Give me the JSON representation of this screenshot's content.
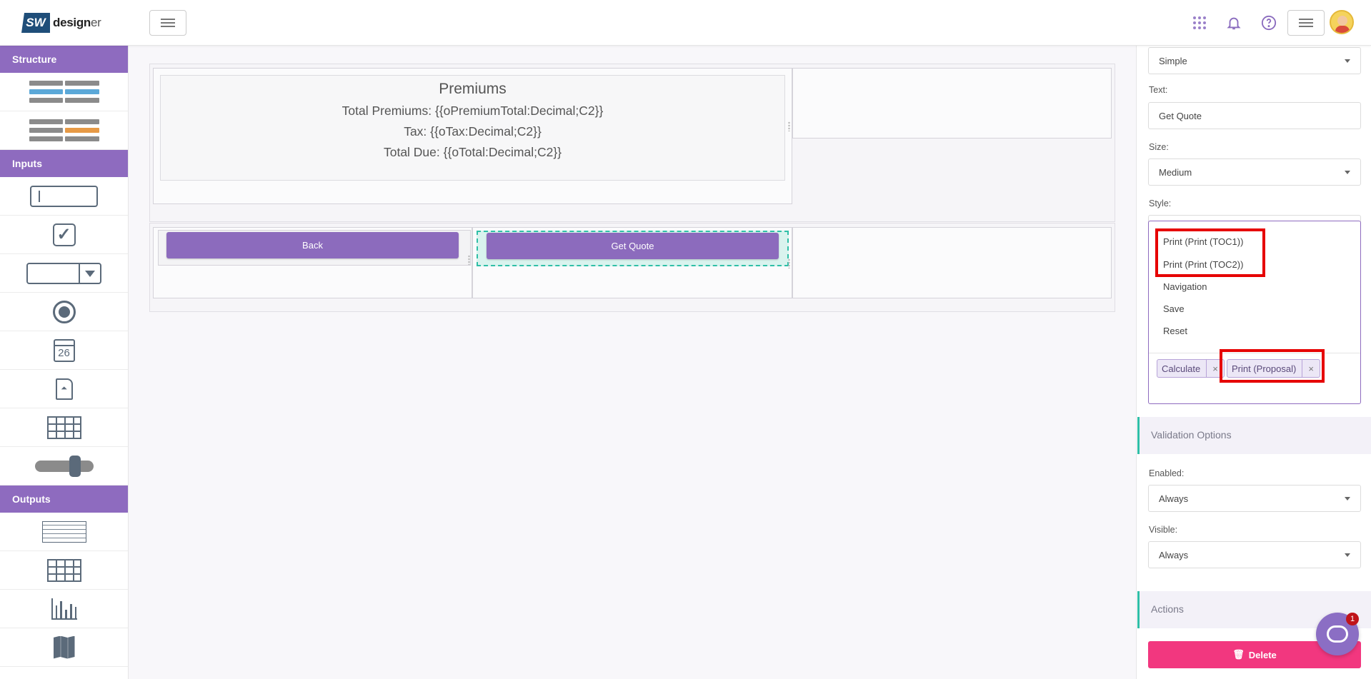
{
  "brand": {
    "box": "SW",
    "name": "design",
    "name_suffix": "er"
  },
  "sidebar": {
    "sections": [
      "Structure",
      "Inputs",
      "Outputs"
    ],
    "calendar_day": "26"
  },
  "canvas": {
    "premiums": {
      "title": "Premiums",
      "total_premiums": "Total Premiums: {{oPremiumTotal:Decimal;C2}}",
      "tax": "Tax: {{oTax:Decimal;C2}}",
      "total_due": "Total Due: {{oTotal:Decimal;C2}}"
    },
    "back_button": "Back",
    "get_quote_button": "Get Quote"
  },
  "panel": {
    "type_value": "Simple",
    "text_label": "Text:",
    "text_value": "Get Quote",
    "size_label": "Size:",
    "size_value": "Medium",
    "style_label": "Style:",
    "dropdown_items": [
      "Print (Print (TOC1))",
      "Print (Print (TOC2))",
      "Navigation",
      "Save",
      "Reset"
    ],
    "chips": [
      "Calculate",
      "Print (Proposal)"
    ],
    "chip_remove": "×",
    "validation_header": "Validation Options",
    "enabled_label": "Enabled:",
    "enabled_value": "Always",
    "visible_label": "Visible:",
    "visible_value": "Always",
    "actions_header": "Actions",
    "delete_button": "Delete"
  },
  "chat": {
    "badge": "1"
  },
  "colors": {
    "accent": "#8e6bbf",
    "teal": "#2fbfa7",
    "danger": "#f2377f",
    "highlight": "#e60000"
  }
}
